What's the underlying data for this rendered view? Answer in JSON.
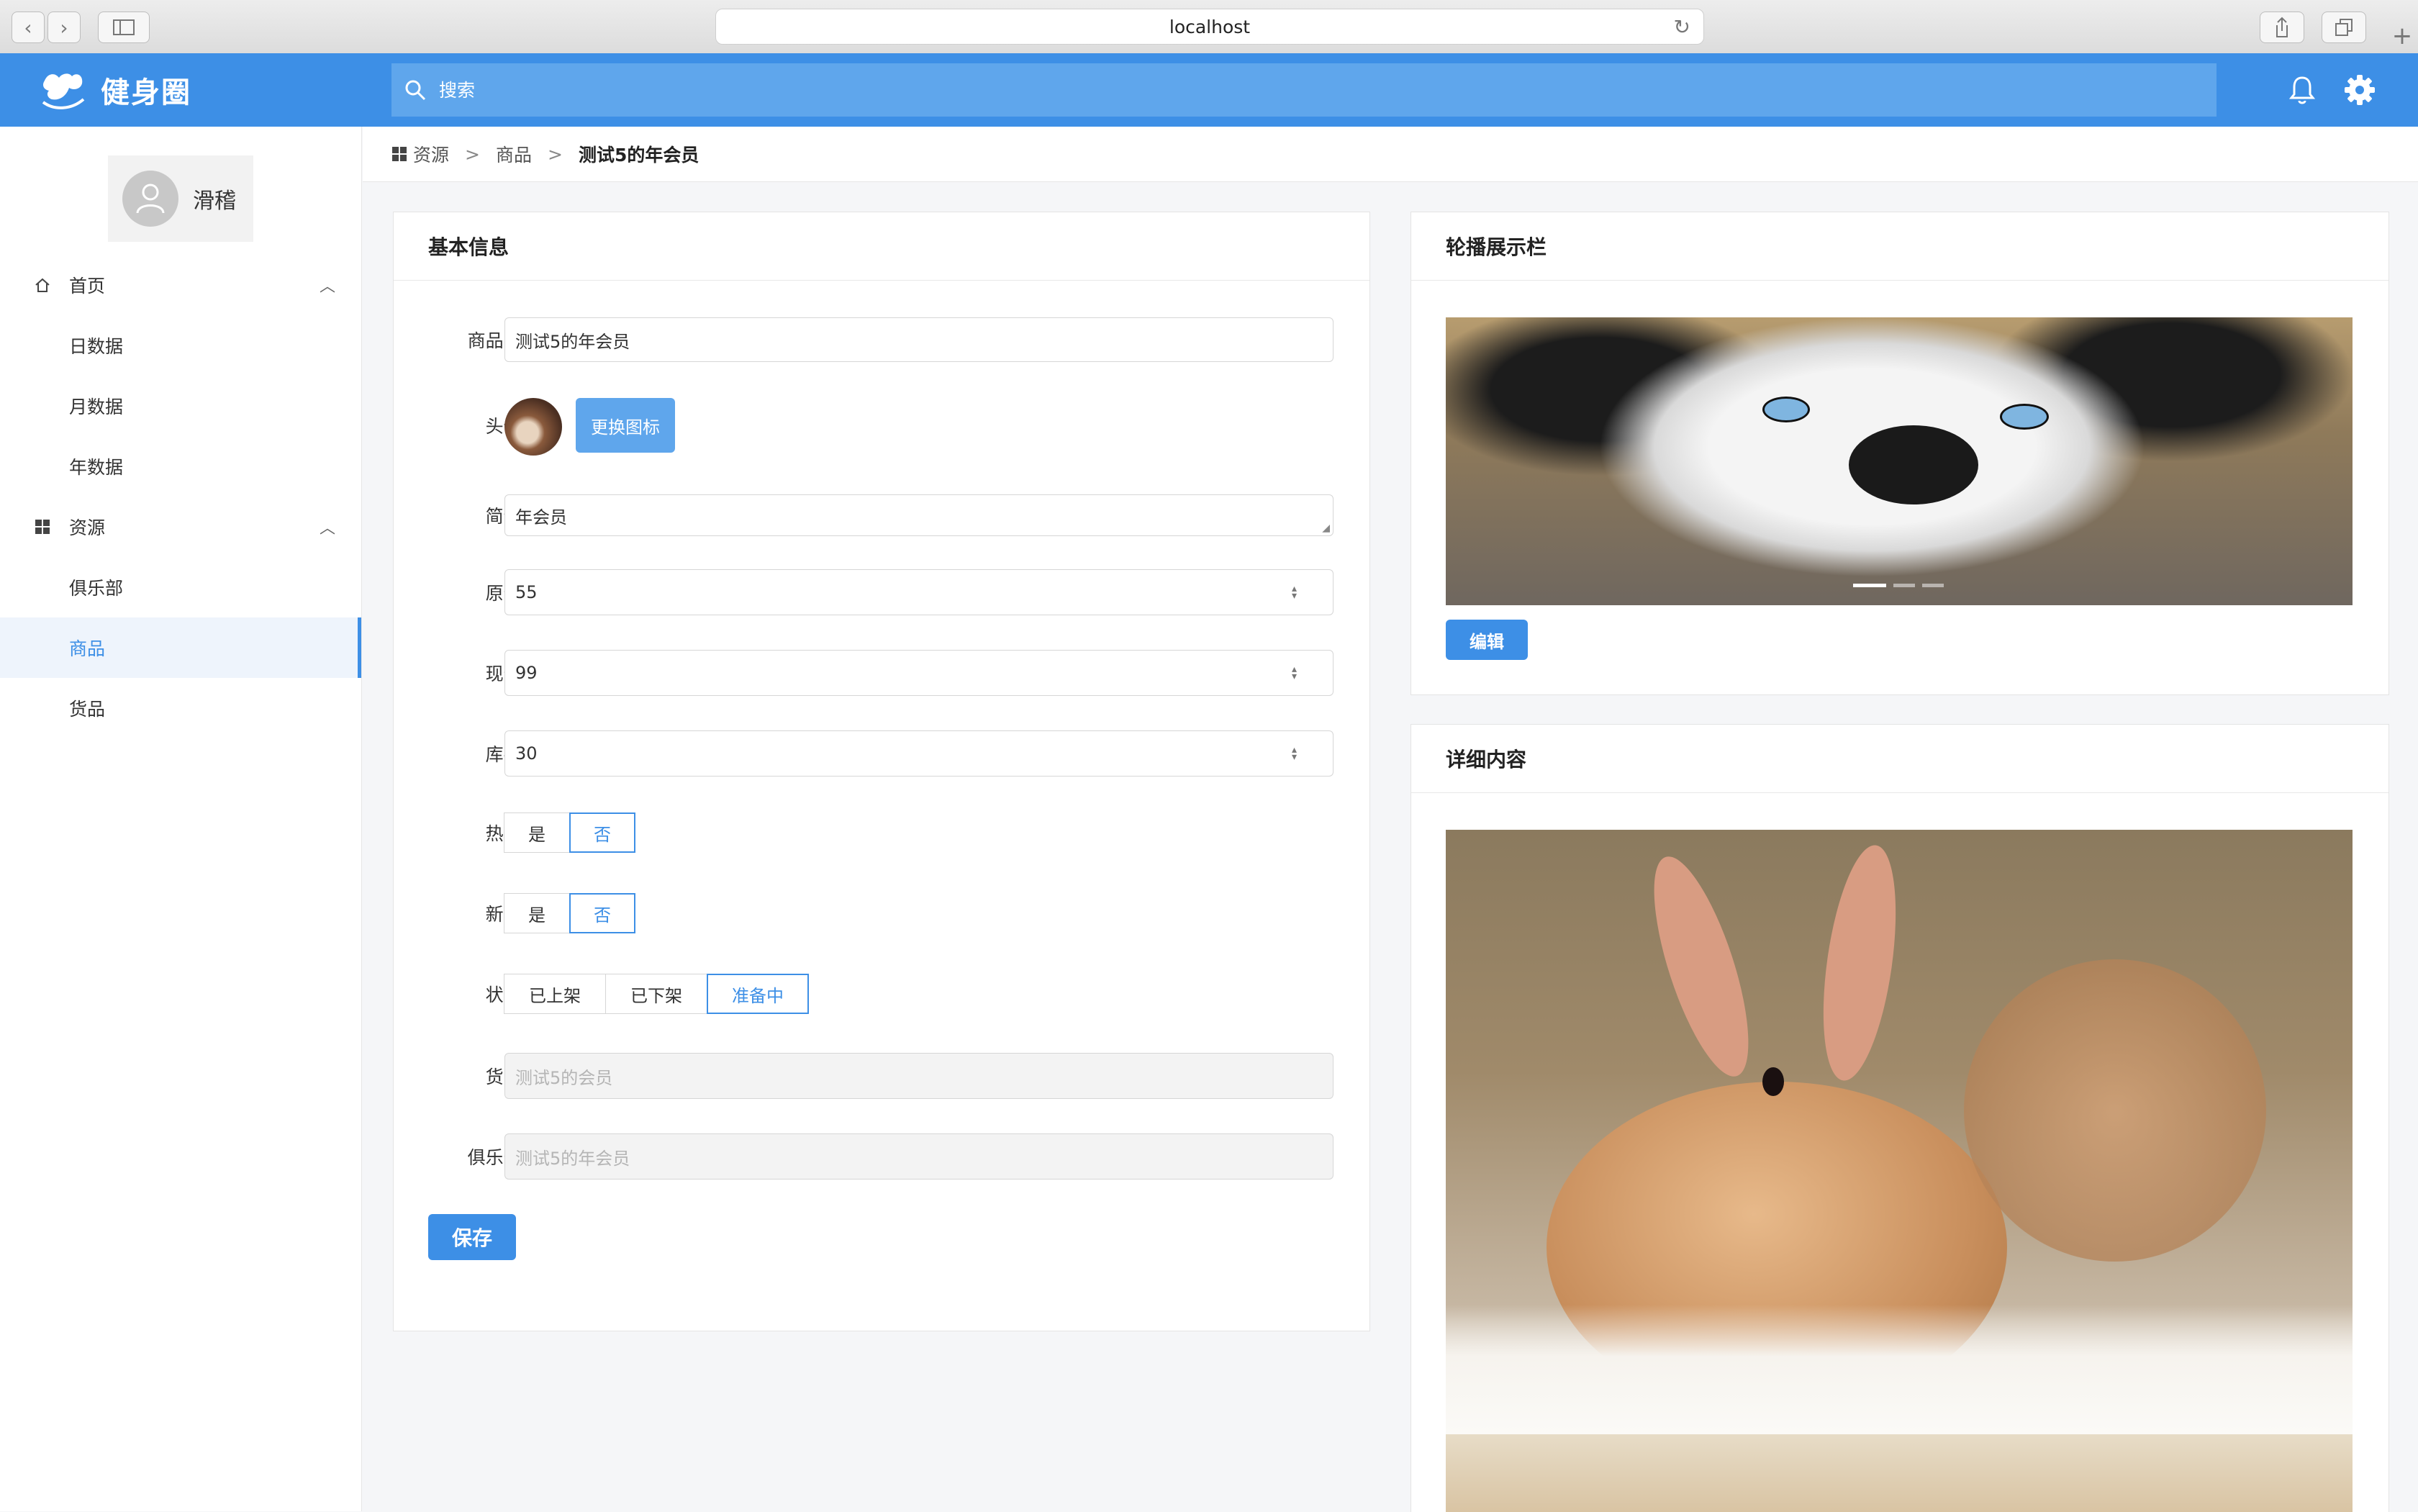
{
  "browser": {
    "url": "localhost"
  },
  "app": {
    "name": "健身圈",
    "brand_color": "#3d8fe6"
  },
  "search": {
    "placeholder": "搜索"
  },
  "user": {
    "name": "滑稽"
  },
  "sidebar": {
    "groups": [
      {
        "label": "首页",
        "items": [
          "日数据",
          "月数据",
          "年数据"
        ]
      },
      {
        "label": "资源",
        "items": [
          "俱乐部",
          "商品",
          "货品"
        ]
      }
    ],
    "active_item": "商品"
  },
  "breadcrumb": {
    "items": [
      "资源",
      "商品"
    ],
    "current": "测试5的年会员",
    "separator": ">"
  },
  "basic_info": {
    "title": "基本信息",
    "fields": {
      "name": {
        "label": "商品名:",
        "value": "测试5的年会员"
      },
      "avatar": {
        "label": "头像:",
        "button": "更换图标"
      },
      "intro": {
        "label": "简介:",
        "value": "年会员"
      },
      "original_price": {
        "label": "原价:",
        "value": "55"
      },
      "current_price": {
        "label": "现价:",
        "value": "99"
      },
      "stock": {
        "label": "库存:",
        "value": "30"
      },
      "hot": {
        "label": "热门:",
        "options": [
          "是",
          "否"
        ],
        "selected": "否"
      },
      "new": {
        "label": "新品:",
        "options": [
          "是",
          "否"
        ],
        "selected": "否"
      },
      "status": {
        "label": "状态:",
        "options": [
          "已上架",
          "已下架",
          "准备中"
        ],
        "selected": "准备中"
      },
      "goods": {
        "label": "货品:",
        "placeholder": "测试5的会员"
      },
      "club": {
        "label": "俱乐部:",
        "placeholder": "测试5的年会员"
      }
    },
    "save_button": "保存"
  },
  "carousel": {
    "title": "轮播展示栏",
    "edit_button": "编辑",
    "slide_count": 3,
    "active_slide": 1
  },
  "detail": {
    "title": "详细内容"
  }
}
